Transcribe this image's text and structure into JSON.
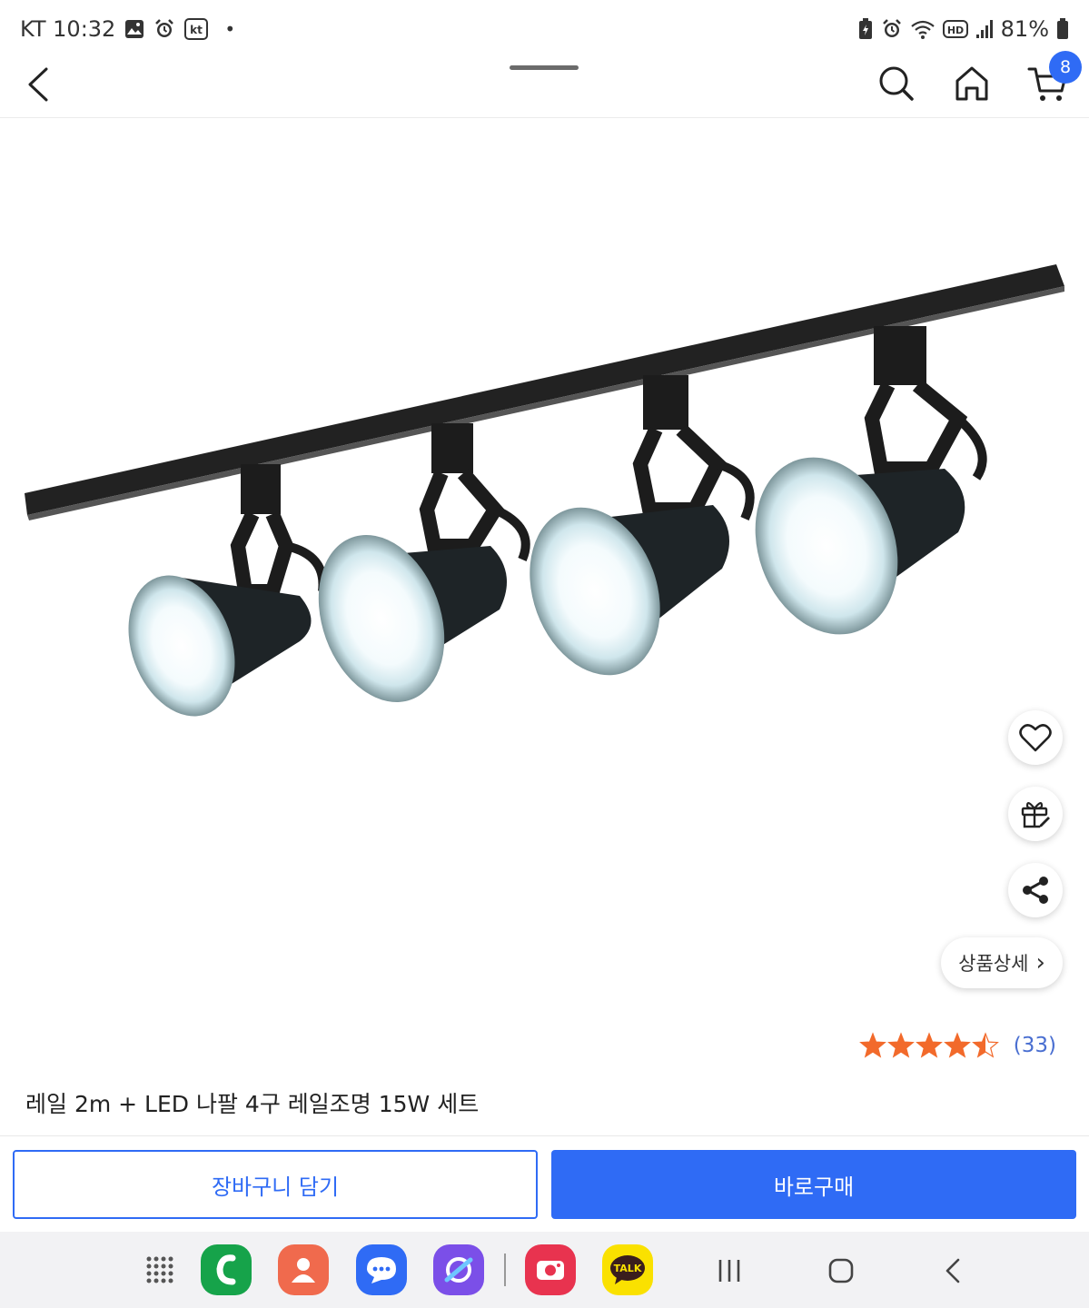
{
  "status_bar": {
    "carrier_time": "KT 10:32",
    "dot": "•",
    "battery": "81%",
    "icons_left": [
      "gallery-icon",
      "alarm-icon",
      "kt-app-icon"
    ],
    "icons_right": [
      "battery-saver-icon",
      "alarm-icon",
      "wifi-icon",
      "hd-voice-icon",
      "signal-icon",
      "battery-icon"
    ],
    "kt_badge": "kt",
    "hd_label": "HD"
  },
  "header": {
    "cart_count": "8",
    "icons": [
      "back-icon",
      "search-icon",
      "home-icon",
      "cart-icon"
    ]
  },
  "product": {
    "title": "레일 2m + LED 나팔 4구 레일조명 15W 세트",
    "rating": 4.5,
    "review_count": "(33)",
    "detail_link": "상품상세",
    "detail_arrow": "›"
  },
  "floating_actions": [
    "heart-icon",
    "gift-icon",
    "share-icon"
  ],
  "actions": {
    "cart_button": "장바구니 담기",
    "buy_button": "바로구매"
  },
  "dock": {
    "apps": [
      "apps-grid-icon",
      "phone-app",
      "contacts-app",
      "messages-app",
      "internet-app",
      "screen-recorder-app",
      "kakaotalk-app"
    ],
    "kakao_label": "TALK"
  },
  "nav_keys": [
    "recents-icon",
    "home-key-icon",
    "back-key-icon"
  ],
  "colors": {
    "accent": "#2f6bf5",
    "star": "#f26a2b",
    "review_count": "#4a6fd1"
  }
}
